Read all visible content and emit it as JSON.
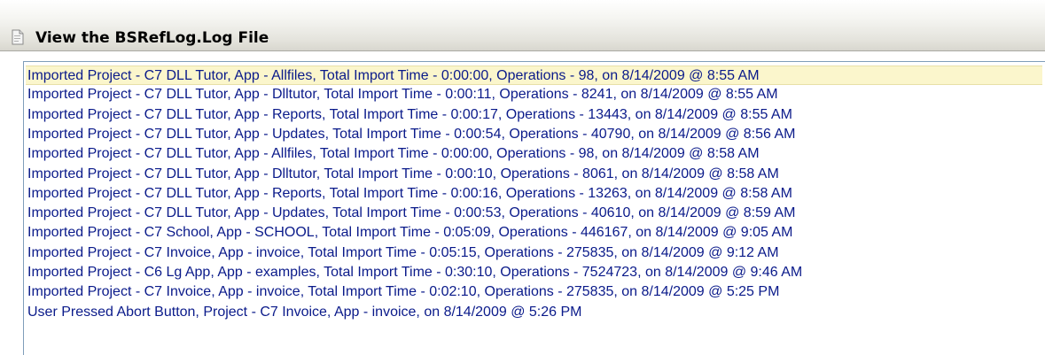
{
  "window": {
    "title": "View the BSRefLog.Log File",
    "title_icon": "document-icon"
  },
  "colors": {
    "list_text": "#0a1a8a",
    "selected_background": "#fbf6cc",
    "list_border": "#7f9db9"
  },
  "log": {
    "selected_index": 0,
    "entries": [
      "Imported Project - C7 DLL Tutor, App - Allfiles, Total Import Time -  0:00:00, Operations - 98, on  8/14/2009 @  8:55 AM",
      "Imported Project - C7 DLL Tutor, App - Dlltutor, Total Import Time -  0:00:11, Operations - 8241, on  8/14/2009 @  8:55 AM",
      "Imported Project - C7 DLL Tutor, App - Reports, Total Import Time -  0:00:17, Operations - 13443, on  8/14/2009 @  8:55 AM",
      "Imported Project - C7 DLL Tutor, App - Updates, Total Import Time -  0:00:54, Operations - 40790, on  8/14/2009 @  8:56 AM",
      "Imported Project - C7 DLL Tutor, App - Allfiles, Total Import Time -  0:00:00, Operations - 98, on  8/14/2009 @  8:58 AM",
      "Imported Project - C7 DLL Tutor, App - Dlltutor, Total Import Time -  0:00:10, Operations - 8061, on  8/14/2009 @  8:58 AM",
      "Imported Project - C7 DLL Tutor, App - Reports, Total Import Time -  0:00:16, Operations - 13263, on  8/14/2009 @  8:58 AM",
      "Imported Project - C7 DLL Tutor, App - Updates, Total Import Time -  0:00:53, Operations - 40610, on  8/14/2009 @  8:59 AM",
      "Imported Project - C7 School, App - SCHOOL, Total Import Time -  0:05:09, Operations - 446167, on  8/14/2009 @  9:05 AM",
      "Imported Project - C7 Invoice, App - invoice, Total Import Time -  0:05:15, Operations - 275835, on  8/14/2009 @  9:12 AM",
      "Imported Project - C6 Lg App, App - examples, Total Import Time -  0:30:10, Operations - 7524723, on  8/14/2009 @  9:46 AM",
      "Imported Project - C7 Invoice, App - invoice, Total Import Time -  0:02:10, Operations - 275835, on  8/14/2009 @  5:25 PM",
      "User Pressed Abort Button, Project - C7 Invoice, App - invoice, on  8/14/2009 @  5:26 PM"
    ]
  }
}
